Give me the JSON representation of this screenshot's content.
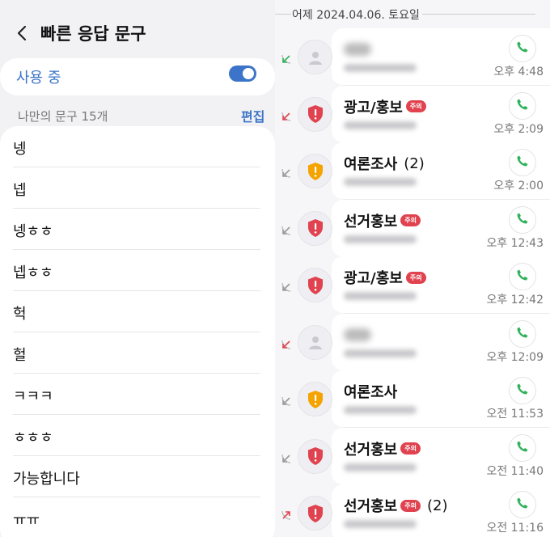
{
  "left": {
    "title": "빠른 응답 문구",
    "toggle_label": "사용 중",
    "toggle_on": true,
    "subheader": "나만의 문구 15개",
    "edit_label": "편집",
    "phrases": [
      "넹",
      "넵",
      "넹ㅎㅎ",
      "넵ㅎㅎ",
      "헉",
      "헐",
      "ㅋㅋㅋ",
      "ㅎㅎㅎ",
      "가능합니다",
      "ㅠㅠ"
    ]
  },
  "right": {
    "date_header": "어제 2024.04.06. 토요일",
    "calls": [
      {
        "name": "",
        "badge": "",
        "count": "",
        "time": "오후 4:48",
        "type": "unknown",
        "dir": "in"
      },
      {
        "name": "광고/홍보",
        "badge": "주의",
        "count": "",
        "time": "오후 2:09",
        "type": "red",
        "dir": "missed"
      },
      {
        "name": "여론조사",
        "badge": "",
        "count": "(2)",
        "time": "오후 2:00",
        "type": "orange",
        "dir": "rejected"
      },
      {
        "name": "선거홍보",
        "badge": "주의",
        "count": "",
        "time": "오후 12:43",
        "type": "red",
        "dir": "rejected"
      },
      {
        "name": "광고/홍보",
        "badge": "주의",
        "count": "",
        "time": "오후 12:42",
        "type": "red",
        "dir": "rejected"
      },
      {
        "name": "",
        "badge": "",
        "count": "",
        "time": "오후 12:09",
        "type": "unknown",
        "dir": "missed"
      },
      {
        "name": "여론조사",
        "badge": "",
        "count": "",
        "time": "오전 11:53",
        "type": "orange",
        "dir": "rejected"
      },
      {
        "name": "선거홍보",
        "badge": "주의",
        "count": "",
        "time": "오전 11:40",
        "type": "red",
        "dir": "rejected"
      },
      {
        "name": "선거홍보",
        "badge": "주의",
        "count": "(2)",
        "time": "오전 11:16",
        "type": "red",
        "dir": "out"
      }
    ]
  },
  "colors": {
    "accent": "#3b74c8",
    "danger": "#e0434f",
    "warning": "#f4a300",
    "call_green": "#2fb25a"
  }
}
